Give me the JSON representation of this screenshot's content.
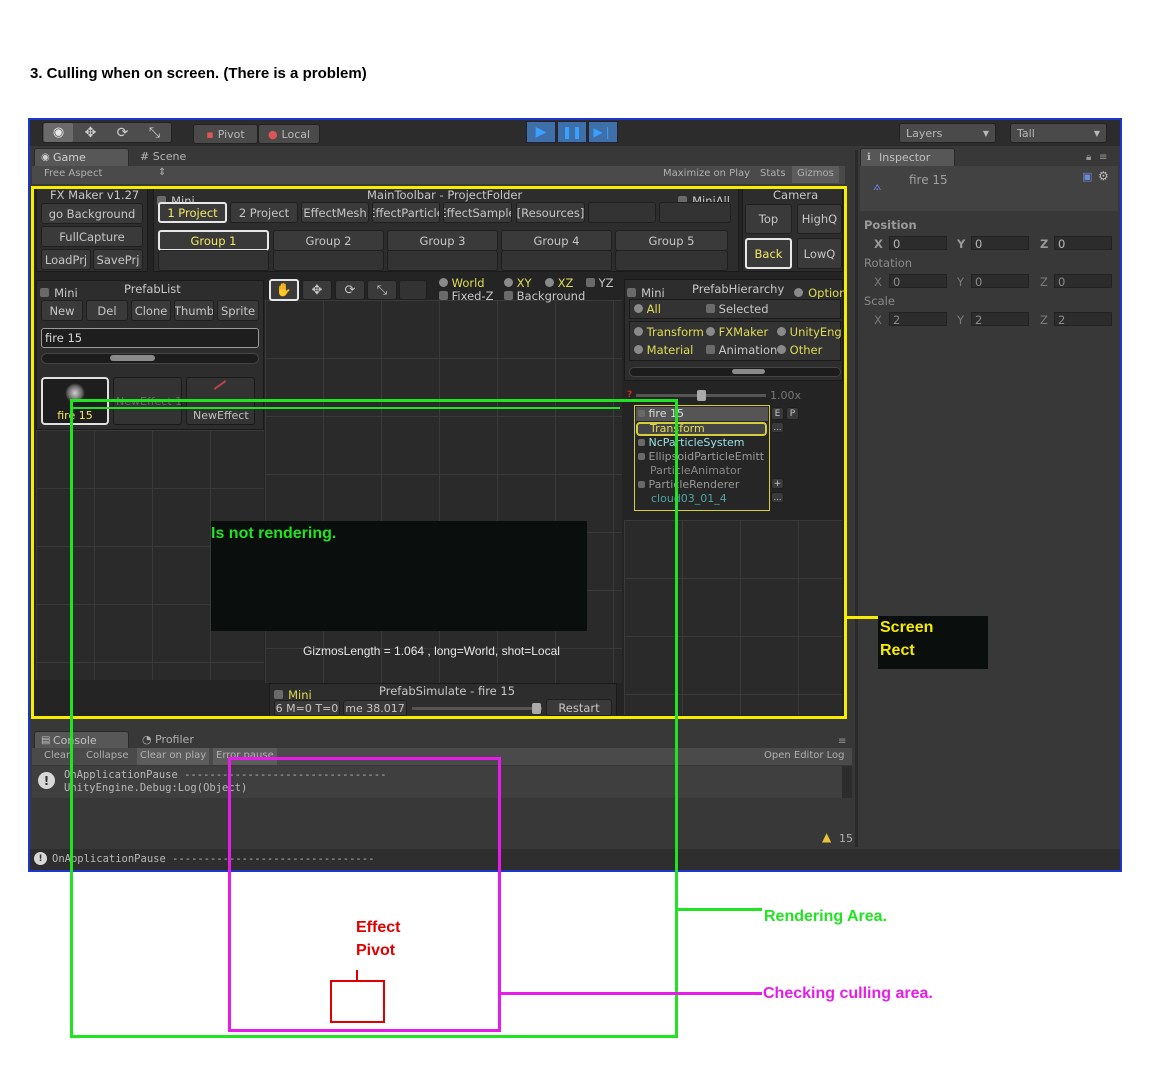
{
  "heading": "3. Culling when on screen. (There is a problem)",
  "toolbar": {
    "pivot": "Pivot",
    "local": "Local",
    "layers": "Layers",
    "layout": "Tall"
  },
  "game_tab": {
    "game": "Game",
    "scene": "Scene",
    "aspect": "Free Aspect",
    "maximize": "Maximize on Play",
    "stats": "Stats",
    "gizmos": "Gizmos"
  },
  "fxmaker": {
    "version": "FX Maker v1.27",
    "go_background": "go Background",
    "full_capture": "FullCapture",
    "load_prj": "LoadPrj",
    "save_prj": "SavePrj",
    "mini": "Mini",
    "main_toolbar_title": "MainToolbar - ProjectFolder",
    "mini_all": "MiniAll",
    "projects": [
      "1 Project",
      "2 Project",
      "[EffectMesh]",
      "EffectParticle",
      "EffectSample",
      "[Resources]"
    ],
    "groups": [
      "Group 1",
      "Group 2",
      "Group 3",
      "Group 4",
      "Group 5"
    ],
    "camera": "Camera",
    "cam_top": "Top",
    "cam_highq": "HighQ",
    "cam_back": "Back",
    "cam_lowq": "LowQ"
  },
  "prefab_list": {
    "mini": "Mini",
    "title": "PrefabList",
    "buttons": [
      "New",
      "Del",
      "Clone",
      "Thumb",
      "Sprite"
    ],
    "search": "fire 15",
    "items": [
      "fire 15",
      "NewEffect 1",
      "NewEffect"
    ]
  },
  "view_options": {
    "world": "World",
    "fixed_z": "Fixed-Z",
    "xy": "XY",
    "xz": "XZ",
    "yz": "YZ",
    "background": "Background"
  },
  "hierarchy": {
    "mini": "Mini",
    "title": "PrefabHierarchy",
    "option": "Option",
    "all": "All",
    "selected": "Selected",
    "filters": [
      "Transform",
      "FXMaker",
      "UnityEngi",
      "Material",
      "Animation",
      "Other"
    ],
    "zoom": "1.00x",
    "tree": [
      "fire 15",
      "Transform",
      "NcParticleSystem",
      "EllipsoidParticleEmitt",
      "ParticleAnimator",
      "ParticleRenderer",
      "cloud03_01_4"
    ],
    "e": "E",
    "p": "P"
  },
  "viewport": {
    "not_rendering": "Is not rendering.",
    "gizmos_info": "GizmosLength = 1.064 , long=World, shot=Local"
  },
  "simulate": {
    "mini": "Mini",
    "title": "PrefabSimulate - fire 15",
    "stats": "6 M=0 T=0",
    "time": "me 38.017",
    "restart": "Restart"
  },
  "inspector": {
    "tab": "Inspector",
    "object": "fire 15",
    "position": "Position",
    "rotation": "Rotation",
    "scale": "Scale",
    "pos": [
      "0",
      "0",
      "0"
    ],
    "rot": [
      "0",
      "0",
      "0"
    ],
    "scl": [
      "2",
      "2",
      "2"
    ],
    "axes": [
      "X",
      "Y",
      "Z"
    ]
  },
  "console": {
    "tab": "Console",
    "profiler": "Profiler",
    "clear": "Clear",
    "collapse": "Collapse",
    "clear_on_play": "Clear on play",
    "error_pause": "Error pause",
    "open_log": "Open Editor Log",
    "line1": "OnApplicationPause --------------------------------",
    "line2": "UnityEngine.Debug:Log(Object)",
    "count": "15",
    "status": "OnApplicationPause --------------------------------"
  },
  "annotations": {
    "screen_rect": [
      "Screen",
      "Rect"
    ],
    "rendering_area": "Rendering Area.",
    "checking_culling": "Checking culling area.",
    "effect_pivot": [
      "Effect",
      "Pivot"
    ]
  },
  "colors": {
    "screen_rect": "#f5ec00",
    "rendering_area": "#22e322",
    "culling_area": "#e81ce8",
    "pivot": "#e00000",
    "frame_border": "#1b36c8"
  }
}
